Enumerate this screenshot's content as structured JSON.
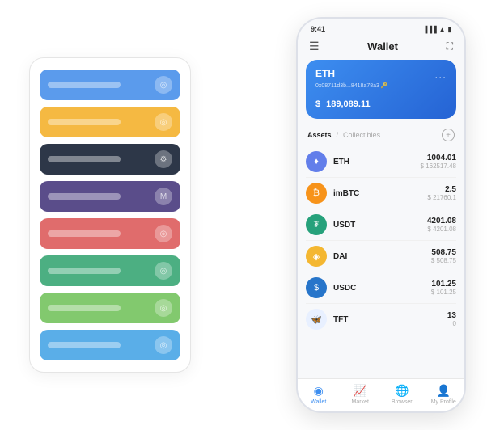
{
  "scene": {
    "card_stack": {
      "cards": [
        {
          "color": "card-blue",
          "icon": "◎"
        },
        {
          "color": "card-yellow",
          "icon": "◎"
        },
        {
          "color": "card-dark",
          "icon": "⚙"
        },
        {
          "color": "card-purple",
          "icon": "M"
        },
        {
          "color": "card-red",
          "icon": "◎"
        },
        {
          "color": "card-green",
          "icon": "◎"
        },
        {
          "color": "card-lightgreen",
          "icon": "◎"
        },
        {
          "color": "card-sky",
          "icon": "◎"
        }
      ]
    },
    "phone": {
      "status_bar": {
        "time": "9:41",
        "signal": "▐▐▐",
        "wifi": "▲",
        "battery": "▮"
      },
      "header": {
        "menu_icon": "☰",
        "title": "Wallet",
        "expand_icon": "⛶"
      },
      "eth_card": {
        "label": "ETH",
        "more_icon": "...",
        "address": "0x08711d3b...8418a78a3 🔑",
        "balance_prefix": "$",
        "balance": "189,089.11"
      },
      "assets_header": {
        "tab_active": "Assets",
        "separator": "/",
        "tab_inactive": "Collectibles",
        "add_icon": "+"
      },
      "assets": [
        {
          "name": "ETH",
          "icon_letter": "♦",
          "icon_class": "eth-icon",
          "amount": "1004.01",
          "usd": "$ 162517.48"
        },
        {
          "name": "imBTC",
          "icon_letter": "₿",
          "icon_class": "imbtc-icon",
          "amount": "2.5",
          "usd": "$ 21760.1"
        },
        {
          "name": "USDT",
          "icon_letter": "₮",
          "icon_class": "usdt-icon",
          "amount": "4201.08",
          "usd": "$ 4201.08"
        },
        {
          "name": "DAI",
          "icon_letter": "◈",
          "icon_class": "dai-icon",
          "amount": "508.75",
          "usd": "$ 508.75"
        },
        {
          "name": "USDC",
          "icon_letter": "$",
          "icon_class": "usdc-icon",
          "amount": "101.25",
          "usd": "$ 101.25"
        },
        {
          "name": "TFT",
          "icon_letter": "🦋",
          "icon_class": "tft-icon",
          "amount": "13",
          "usd": "0"
        }
      ],
      "nav": [
        {
          "icon": "◉",
          "label": "Wallet",
          "active": true
        },
        {
          "icon": "📈",
          "label": "Market",
          "active": false
        },
        {
          "icon": "🌐",
          "label": "Browser",
          "active": false
        },
        {
          "icon": "👤",
          "label": "My Profile",
          "active": false
        }
      ]
    }
  }
}
